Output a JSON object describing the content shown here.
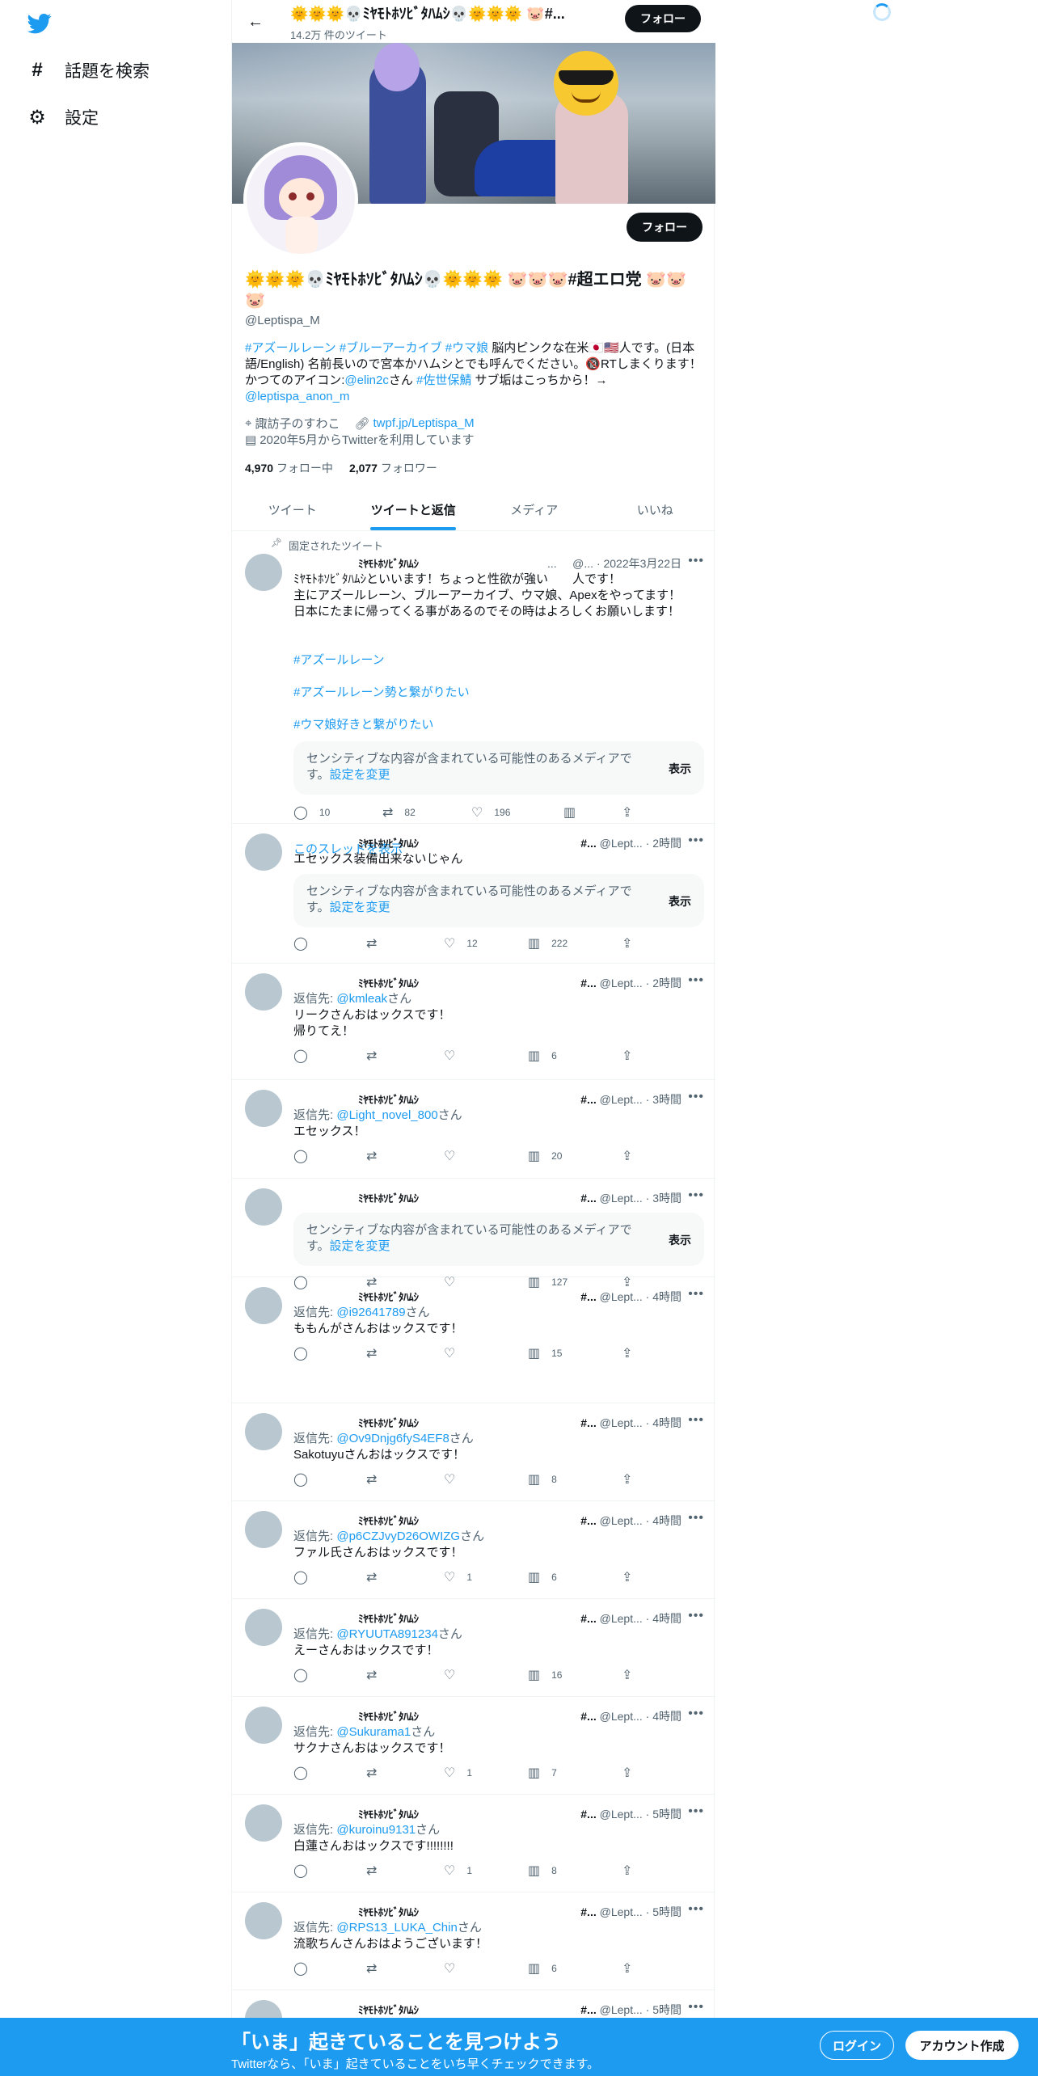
{
  "sidebar": {
    "items": [
      {
        "icon": "hash-icon",
        "glyph": "#",
        "label": "話題を検索"
      },
      {
        "icon": "gear-icon",
        "glyph": "⚙",
        "label": "設定"
      }
    ]
  },
  "profile": {
    "top_name": "🌞🌞🌞💀ﾐﾔﾓﾄﾎｿﾋﾞﾀﾊﾑｼ💀🌞🌞🌞 🐷#...",
    "tweet_count": "14.2万 件のツイート",
    "follow_label": "フォロー",
    "display_name": "🌞🌞🌞💀ﾐﾔﾓﾄﾎｿﾋﾞﾀﾊﾑｼ💀🌞🌞🌞 🐷🐷🐷#超エロ党 🐷🐷🐷",
    "handle": "@Leptispa_M",
    "bio_tags": "#アズールレーン #ブルーアーカイブ #ウマ娘",
    "bio_text1": " 脳内ピンクな在米🇯🇵🇺🇸人です。(日本語/English) 名前長いので宮本かハムシとでも呼んでください。🔞RTしまくります！ かつてのアイコン:",
    "bio_link1": "@elin2c",
    "bio_text2": "さん ",
    "bio_tag2": "#佐世保鯖",
    "bio_text3": " サブ垢はこっちから！→ ",
    "bio_link2": "@leptispa_anon_m",
    "location": "諏訪子のすわこ",
    "url": "twpf.jp/Leptispa_M",
    "joined": "2020年5月からTwitterを利用しています",
    "following_count": "4,970",
    "following_label": "フォロー中",
    "followers_count": "2,077",
    "followers_label": "フォロワー"
  },
  "tabs": [
    "ツイート",
    "ツイートと返信",
    "メディア",
    "いいね"
  ],
  "common": {
    "author_name": "ﾐﾔﾓﾄﾎｿﾋﾞﾀﾊﾑｼ",
    "sensitive_text": "センシティブな内容が含まれている可能性のあるメディアです。",
    "sensitive_link": "設定を変更",
    "show_label": "表示",
    "reply_prefix": "返信先: ",
    "reply_suffix": "さん"
  },
  "pinned": {
    "label": "固定されたツイート",
    "right_dots": "...",
    "right_handle": "@...",
    "time": "· 2022年3月22日",
    "text": "ﾐﾔﾓﾄﾎｿﾋﾞﾀﾊﾑｼといいます！ちょっと性欲が強い　　人です！\n主にアズールレーン、ブルーアーカイブ、ウマ娘、Apexをやってます！\n日本にたまに帰ってくる事があるのでその時はよろしくお願いします！",
    "tags": [
      "#アズールレーン",
      "#アズールレーン勢と繋がりたい",
      "#ウマ娘好きと繋がりたい"
    ],
    "replies": "10",
    "retweets": "82",
    "likes": "196",
    "thread_link": "このスレッドを表示"
  },
  "tweets": [
    {
      "tag": "#...",
      "handle": "@Lept...",
      "time": "· 2時間",
      "text": "エセックス装備出来ないじゃん",
      "reply_to": "",
      "sensitive": true,
      "replies": "",
      "retweets": "",
      "likes": "12",
      "views": "222"
    },
    {
      "tag": "#...",
      "handle": "@Lept...",
      "time": "· 2時間",
      "text": "リークさんおはックスです！\n帰りてえ！",
      "reply_to": "@kmleak",
      "sensitive": false,
      "replies": "",
      "retweets": "",
      "likes": "",
      "views": "6"
    },
    {
      "tag": "#...",
      "handle": "@Lept...",
      "time": "· 3時間",
      "text": "エセックス！",
      "reply_to": "@Light_novel_800",
      "sensitive": false,
      "replies": "",
      "retweets": "",
      "likes": "",
      "views": "20"
    },
    {
      "tag": "#...",
      "handle": "@Lept...",
      "time": "· 3時間",
      "text": "",
      "reply_to": "",
      "sensitive": true,
      "replies": "",
      "retweets": "",
      "likes": "",
      "views": "127"
    },
    {
      "tag": "#...",
      "handle": "@Lept...",
      "time": "· 4時間",
      "text": "ももんがさんおはックスです！",
      "reply_to": "@i92641789",
      "sensitive": false,
      "replies": "",
      "retweets": "",
      "likes": "",
      "views": "15"
    },
    {
      "tag": "#...",
      "handle": "@Lept...",
      "time": "· 4時間",
      "text": "Sakotuyuさんおはックスです！",
      "reply_to": "@Ov9Dnjg6fyS4EF8",
      "sensitive": false,
      "replies": "",
      "retweets": "",
      "likes": "",
      "views": "8"
    },
    {
      "tag": "#...",
      "handle": "@Lept...",
      "time": "· 4時間",
      "text": "ファル氏さんおはックスです！",
      "reply_to": "@p6CZJvyD26OWIZG",
      "sensitive": false,
      "replies": "",
      "retweets": "",
      "likes": "1",
      "views": "6"
    },
    {
      "tag": "#...",
      "handle": "@Lept...",
      "time": "· 4時間",
      "text": "えーさんおはックスです！",
      "reply_to": "@RYUUTA891234",
      "sensitive": false,
      "replies": "",
      "retweets": "",
      "likes": "",
      "views": "16"
    },
    {
      "tag": "#...",
      "handle": "@Lept...",
      "time": "· 4時間",
      "text": "サクナさんおはックスです！",
      "reply_to": "@Sukurama1",
      "sensitive": false,
      "replies": "",
      "retweets": "",
      "likes": "1",
      "views": "7"
    },
    {
      "tag": "#...",
      "handle": "@Lept...",
      "time": "· 5時間",
      "text": "白蓮さんおはックスです!!!!!!!!",
      "reply_to": "@kuroinu9131",
      "sensitive": false,
      "replies": "",
      "retweets": "",
      "likes": "1",
      "views": "8"
    },
    {
      "tag": "#...",
      "handle": "@Lept...",
      "time": "· 5時間",
      "text": "流歌ちんさんおはようございます！",
      "reply_to": "@RPS13_LUKA_Chin",
      "sensitive": false,
      "replies": "",
      "retweets": "",
      "likes": "",
      "views": "6"
    },
    {
      "tag": "#...",
      "handle": "@Lept...",
      "time": "· 5時間",
      "text": "",
      "reply_to": "",
      "sensitive": false,
      "replies": "",
      "retweets": "",
      "likes": "",
      "views": ""
    }
  ],
  "bottom": {
    "title": "「いま」起きていることを見つけよう",
    "subtitle": "Twitterなら、「いま」起きていることをいち早くチェックできます。",
    "login": "ログイン",
    "signup": "アカウント作成"
  },
  "colors": {
    "accent": "#1d9bf0",
    "text": "#0f1419",
    "muted": "#536471"
  }
}
